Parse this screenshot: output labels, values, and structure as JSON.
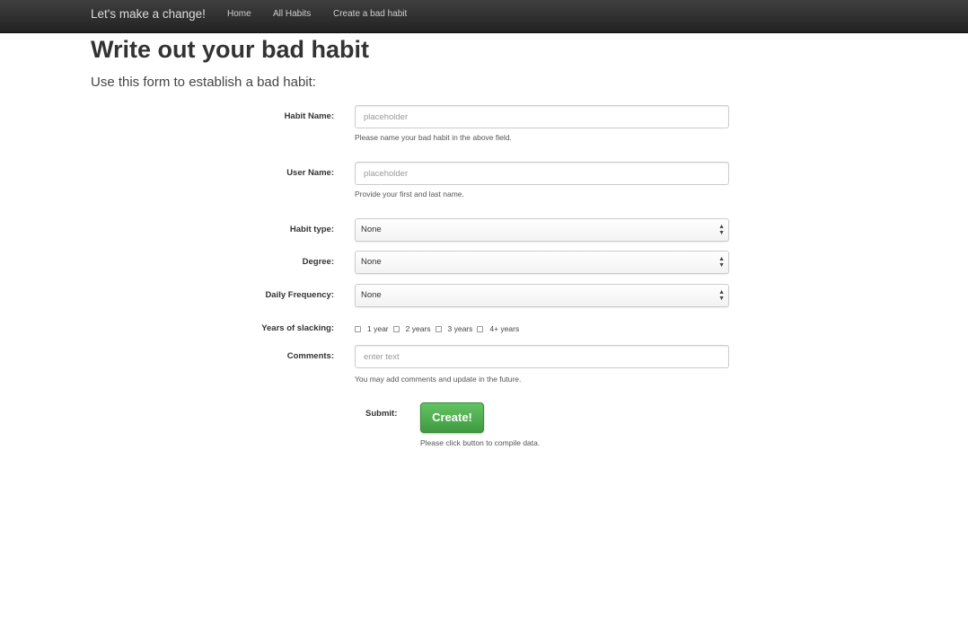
{
  "navbar": {
    "brand": "Let's make a change!",
    "links": [
      "Home",
      "All Habits",
      "Create a bad habit"
    ]
  },
  "page": {
    "title": "Write out your bad habit",
    "lead": "Use this form to establish a bad habit:"
  },
  "form": {
    "habit_name": {
      "label": "Habit Name:",
      "placeholder": "placeholder",
      "help": "Please name your bad habit in the above field."
    },
    "user_name": {
      "label": "User Name:",
      "placeholder": "placeholder",
      "help": "Provide your first and last name."
    },
    "habit_type": {
      "label": "Habit type:",
      "value": "None"
    },
    "degree": {
      "label": "Degree:",
      "value": "None"
    },
    "daily_frequency": {
      "label": "Daily Frequency:",
      "value": "None"
    },
    "years_slacking": {
      "label": "Years of slacking:",
      "options": [
        "1 year",
        "2 years",
        "3 years",
        "4+ years"
      ]
    },
    "comments": {
      "label": "Comments:",
      "placeholder": "enter text",
      "help": "You may add comments and update in the future."
    },
    "submit": {
      "label": "Submit:",
      "button": "Create!",
      "help": "Please click button to compile data."
    }
  }
}
